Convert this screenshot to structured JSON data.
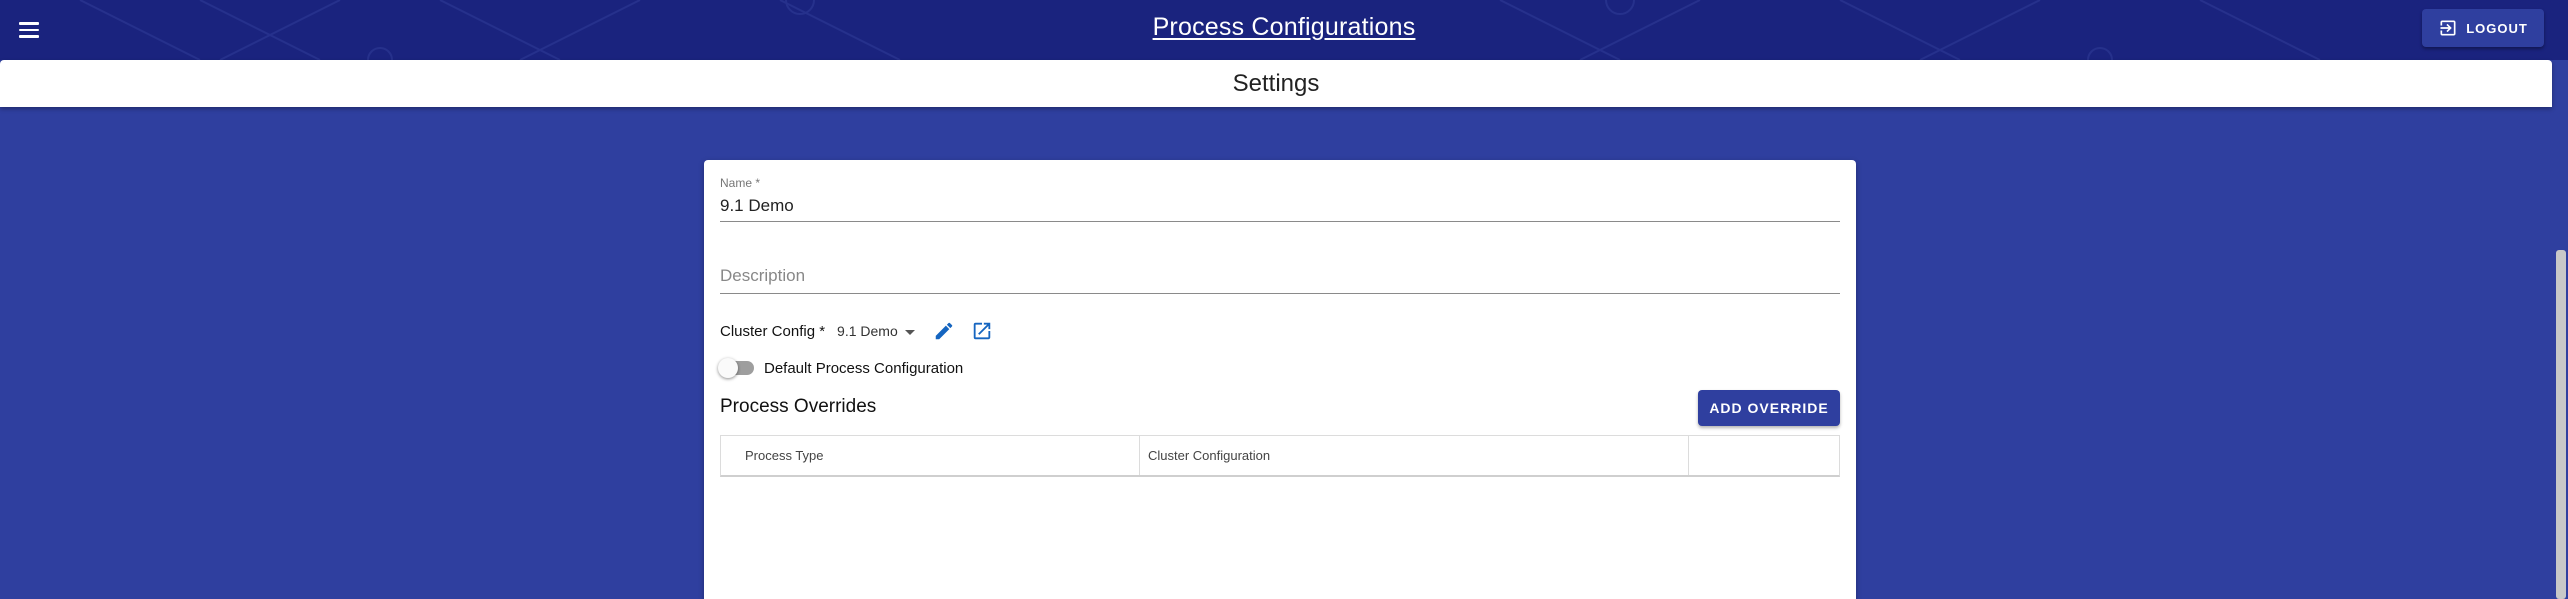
{
  "header": {
    "title": "Process Configurations",
    "logout_label": "LOGOUT"
  },
  "subheader": {
    "title": "Settings"
  },
  "form": {
    "name_label": "Name *",
    "name_value": "9.1 Demo",
    "description_placeholder": "Description",
    "cluster_config_label": "Cluster Config *",
    "cluster_config_value": "9.1 Demo",
    "default_toggle_label": "Default Process Configuration",
    "default_toggle_on": false
  },
  "overrides": {
    "title": "Process Overrides",
    "add_button_label": "ADD OVERRIDE",
    "columns": [
      "Process Type",
      "Cluster Configuration",
      ""
    ]
  },
  "colors": {
    "appbar": "#1a237e",
    "background": "#2f3f9f",
    "accent": "#2f3f9f",
    "icon_blue": "#1565c0"
  }
}
